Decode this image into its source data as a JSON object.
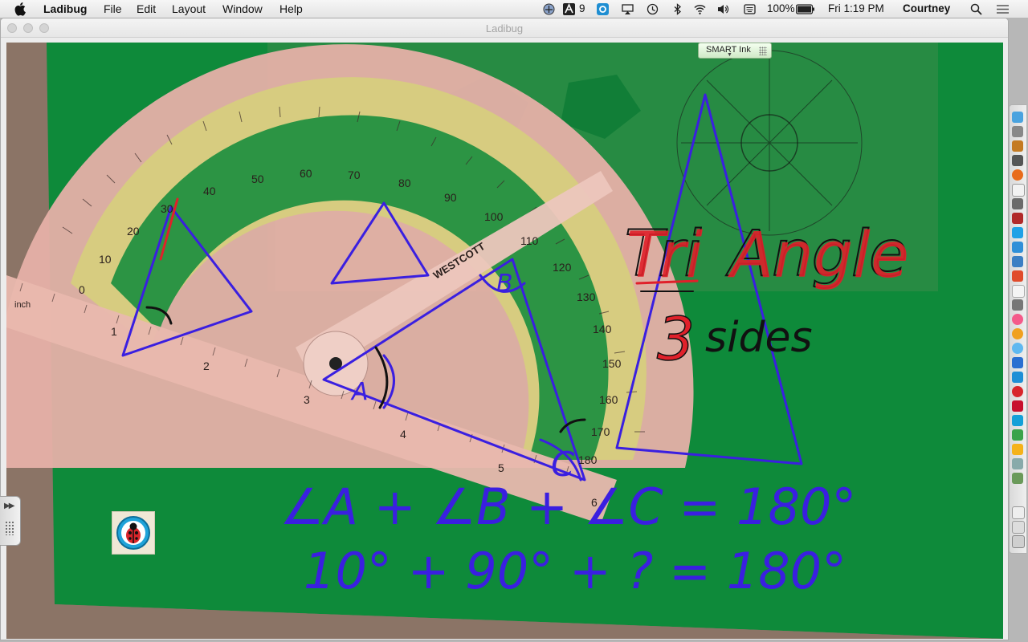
{
  "menubar": {
    "app_name": "Ladibug",
    "menus": [
      "File",
      "Edit",
      "Layout",
      "Window",
      "Help"
    ],
    "status": {
      "adobe_badge": "9",
      "battery": "100%",
      "clock": "Fri 1:19 PM",
      "user": "Courtney"
    }
  },
  "window": {
    "title": "Ladibug",
    "smart_ink_label": "SMART Ink"
  },
  "camera_view": {
    "handwriting": {
      "title_word_1": "Tri",
      "title_word_2": "Angle",
      "subtitle_number": "3",
      "subtitle_word": "sides",
      "angle_label_a": "A",
      "angle_label_b": "B",
      "angle_label_c": "C",
      "equation_line_1": "∠A + ∠B + ∠C = 180°",
      "equation_line_2": "10° + 90° + ? = 180°"
    },
    "protractor_marks": [
      "0",
      "10",
      "20",
      "30",
      "40",
      "50",
      "60",
      "70",
      "80",
      "90",
      "100",
      "110",
      "120",
      "130",
      "140",
      "150",
      "160",
      "170",
      "180"
    ],
    "ruler_brand": "WESTCOTT",
    "ruler_inch_label": "inch",
    "ruler_numbers": [
      "1",
      "2",
      "3",
      "4",
      "5",
      "6"
    ]
  },
  "colors": {
    "board_green": "#0e8a3a",
    "ink_blue": "#3a1fe0",
    "ink_red": "#e0202a",
    "ink_black": "#111111",
    "protractor_pink": "#e9b7ae",
    "protractor_yellow": "#d9d27a"
  }
}
